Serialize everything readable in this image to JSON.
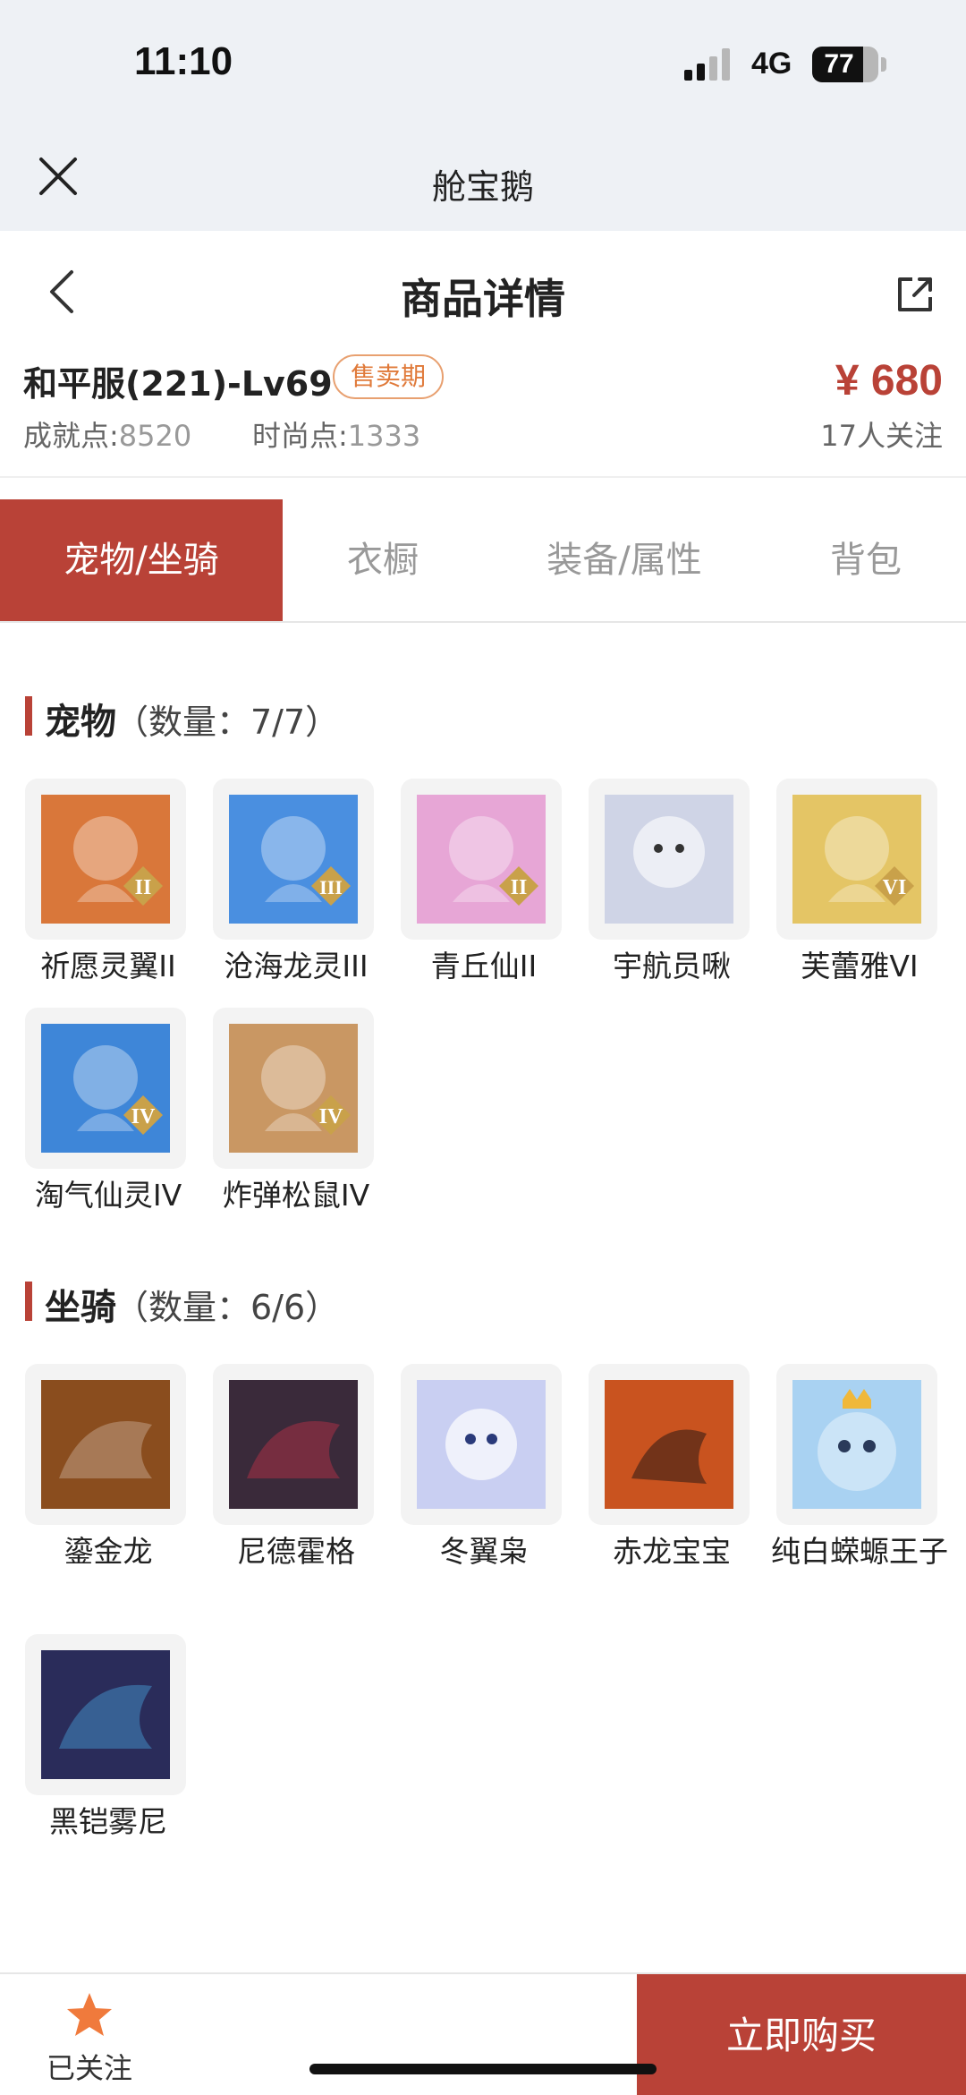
{
  "status": {
    "time": "11:10",
    "network": "4G",
    "battery": "77",
    "battery_level": 0.77
  },
  "app": {
    "title": "舱宝鹅"
  },
  "page": {
    "title": "商品详情"
  },
  "product": {
    "name": "和平服(221)-Lv69",
    "badge": "售卖期",
    "achievement_label": "成就点:",
    "achievement_value": "8520",
    "fashion_label": "时尚点:",
    "fashion_value": "1333",
    "price": "¥ 680",
    "followers": "17人关注"
  },
  "tabs": [
    {
      "label": "宠物/坐骑",
      "active": true
    },
    {
      "label": "衣橱",
      "active": false
    },
    {
      "label": "装备/属性",
      "active": false
    },
    {
      "label": "背包",
      "active": false
    }
  ],
  "pets": {
    "title": "宠物",
    "count": "（数量：7/7）",
    "items": [
      {
        "name": "祈愿灵翼II",
        "rank": "II",
        "color": "#d9773a"
      },
      {
        "name": "沧海龙灵III",
        "rank": "III",
        "color": "#4a8fe0"
      },
      {
        "name": "青丘仙II",
        "rank": "II",
        "color": "#e7a6d6"
      },
      {
        "name": "宇航员啾",
        "rank": "",
        "color": "#cfd4e6"
      },
      {
        "name": "芙蕾雅VI",
        "rank": "VI",
        "color": "#e4c565"
      },
      {
        "name": "淘气仙灵IV",
        "rank": "IV",
        "color": "#3e86d8"
      },
      {
        "name": "炸弹松鼠IV",
        "rank": "IV",
        "color": "#c99763"
      }
    ]
  },
  "mounts": {
    "title": "坐骑",
    "count": "（数量：6/6）",
    "items": [
      {
        "name": "鎏金龙",
        "color": "#8a4d1e"
      },
      {
        "name": "尼德霍格",
        "color": "#3a2a3a"
      },
      {
        "name": "冬翼枭",
        "color": "#c9cff2"
      },
      {
        "name": "赤龙宝宝",
        "color": "#c9531f"
      },
      {
        "name": "纯白蝾螈王子",
        "color": "#a9d2f2"
      },
      {
        "name": "黑铠雾尼",
        "color": "#2a2c5a"
      }
    ]
  },
  "bottom": {
    "follow_label": "已关注",
    "buy_label": "立即购买"
  },
  "colors": {
    "accent": "#b94237",
    "badge": "#e07a3a",
    "star": "#f07a3c"
  }
}
